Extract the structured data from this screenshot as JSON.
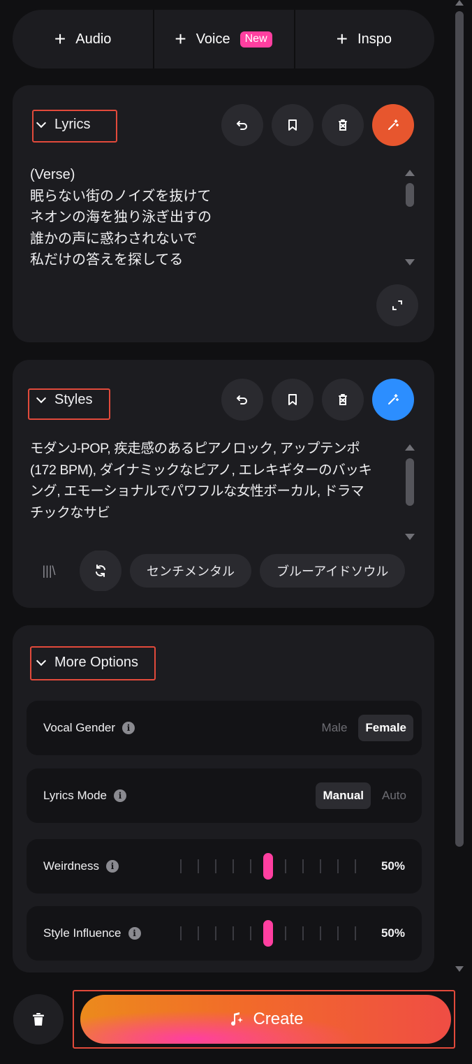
{
  "top_bar": {
    "audio_label": "Audio",
    "voice_label": "Voice",
    "voice_badge": "New",
    "inspo_label": "Inspo"
  },
  "lyrics": {
    "title": "Lyrics",
    "lines": [
      "(Verse)",
      "眠らない街のノイズを抜けて",
      "ネオンの海を独り泳ぎ出すの",
      "誰かの声に惑わされないで",
      "私だけの答えを探してる"
    ],
    "generate_color": "#e7562e"
  },
  "styles": {
    "title": "Styles",
    "lines": [
      "モダンJ-POP, 疾走感のあるピアノロック, アップテンポ",
      "(172 BPM), ダイナミックなピアノ, エレキギターのバッキ",
      "ング, エモーショナルでパワフルな女性ボーカル, ドラマ",
      "チックなサビ"
    ],
    "library_glyph": "|||\\",
    "tags": [
      "センチメンタル",
      "ブルーアイドソウル"
    ],
    "generate_color": "#2c8eff"
  },
  "more_options": {
    "title": "More Options",
    "vocal_gender": {
      "label": "Vocal Gender",
      "options": [
        "Male",
        "Female"
      ],
      "selected": "Female"
    },
    "lyrics_mode": {
      "label": "Lyrics Mode",
      "options": [
        "Manual",
        "Auto"
      ],
      "selected": "Manual"
    },
    "weirdness": {
      "label": "Weirdness",
      "value_text": "50%",
      "value": 0.5
    },
    "style_influence": {
      "label": "Style Influence",
      "value_text": "50%",
      "value": 0.5
    }
  },
  "footer": {
    "create_label": "Create"
  },
  "colors": {
    "accent_pink": "#ff3fa0",
    "highlight_red": "#e24a3b"
  }
}
